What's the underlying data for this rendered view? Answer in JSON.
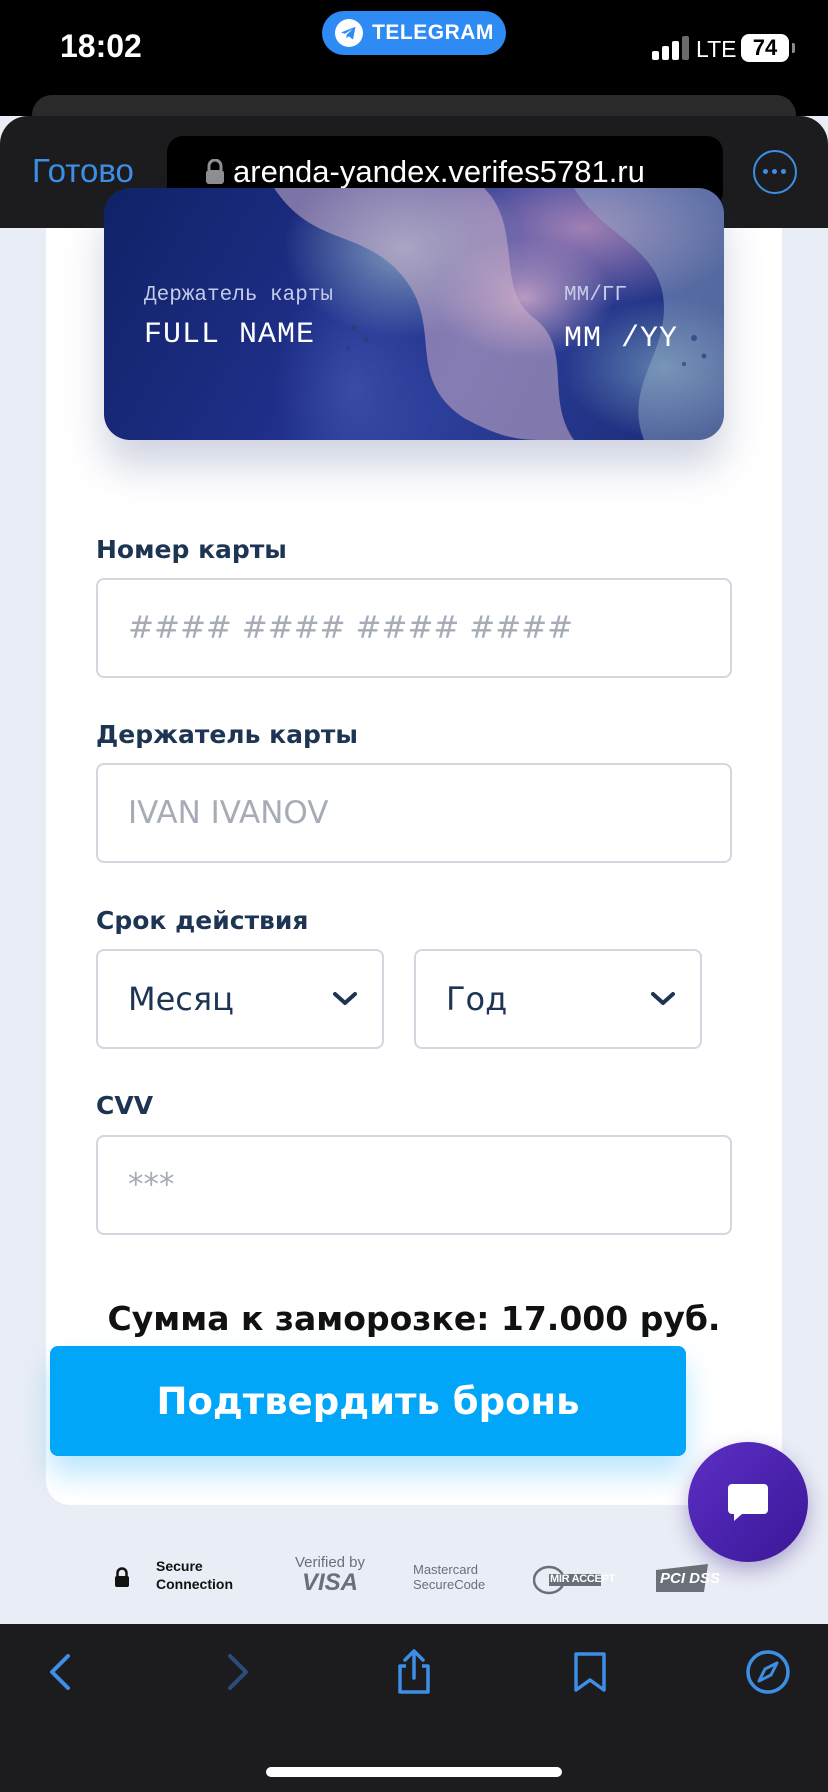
{
  "status_bar": {
    "time": "18:02",
    "app_pill": "TELEGRAM",
    "network": "LTE",
    "battery": "74"
  },
  "browser": {
    "done_label": "Готово",
    "url": "arenda-yandex.verifes5781.ru"
  },
  "card_preview": {
    "holder_label": "Держатель карты",
    "holder_value": "FULL NAME",
    "expiry_label": "ММ/ГГ",
    "expiry_value": "MM /YY"
  },
  "form": {
    "card_number_label": "Номер карты",
    "card_number_placeholder": "#### #### #### ####",
    "holder_label": "Держатель карты",
    "holder_placeholder": "IVAN IVANOV",
    "expiry_label": "Срок действия",
    "month_selected": "Месяц",
    "year_selected": "Год",
    "cvv_label": "CVV",
    "cvv_placeholder": "***"
  },
  "total_text": "Сумма к заморозке: 17.000 руб.",
  "confirm_button": "Подтвердить бронь",
  "badges": {
    "secure_line1": "Secure",
    "secure_line2": "Connection",
    "visa_line1": "Verified by",
    "visa_line2": "VISA",
    "mc_line1": "Mastercard",
    "mc_line2": "SecureCode",
    "mir": "MIR ACCEPT",
    "pci": "PCI DSS"
  },
  "colors": {
    "accent": "#02a6f8",
    "label": "#1d3553",
    "safari_blue": "#3d8fe6",
    "chat": "#4a22ad"
  }
}
